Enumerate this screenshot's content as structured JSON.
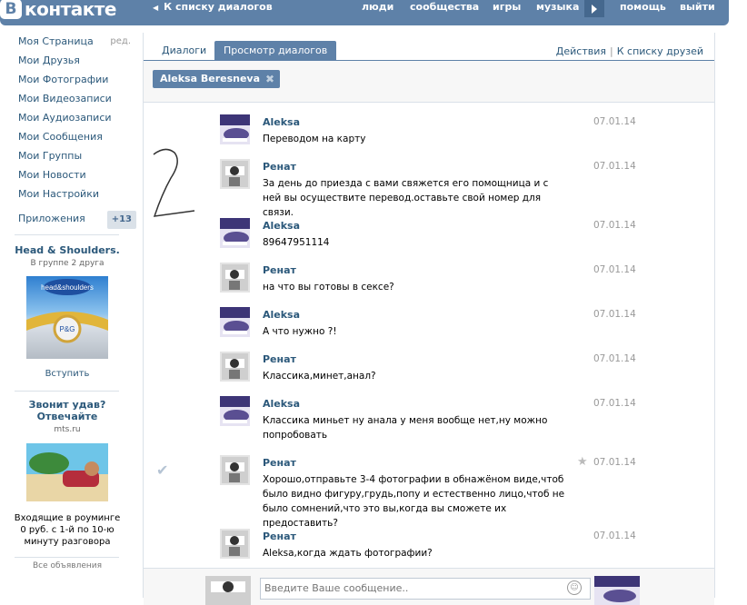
{
  "header": {
    "logo_badge": "В",
    "logo_text": "контакте",
    "back_link": "К списку диалогов",
    "nav": [
      "люди",
      "сообщества",
      "игры",
      "музыка",
      "помощь",
      "выйти"
    ]
  },
  "sidebar": {
    "items": [
      {
        "label": "Моя Страница",
        "edit": "ред."
      },
      {
        "label": "Мои Друзья"
      },
      {
        "label": "Мои Фотографии"
      },
      {
        "label": "Мои Видеозаписи"
      },
      {
        "label": "Мои Аудиозаписи"
      },
      {
        "label": "Мои Сообщения"
      },
      {
        "label": "Мои Группы"
      },
      {
        "label": "Мои Новости"
      },
      {
        "label": "Мои Настройки"
      }
    ],
    "apps": {
      "label": "Приложения",
      "count": "+13"
    },
    "ad1": {
      "title": "Head & Shoulders.",
      "subtitle": "В группе 2 друга",
      "action": "Вступить"
    },
    "ad2": {
      "title": "Звонит удав? Отвечайте",
      "subtitle": "mts.ru",
      "text": "Входящие в роуминге 0 руб. с 1-й по 10-ю минуту разговора"
    },
    "all_ads": "Все объявления"
  },
  "tabs": {
    "dialogs": "Диалоги",
    "view": "Просмотр диалогов",
    "actions": "Действия",
    "sep": "|",
    "friends": "К списку друзей"
  },
  "filter": {
    "chip": "Aleksa Beresneva"
  },
  "messages": [
    {
      "author": "Aleksa",
      "text": "Переводом на карту",
      "date": "07.01.14"
    },
    {
      "author": "Ренат",
      "text": "За день до приезда с вами свяжется его помощница и с ней вы осуществите перевод.оставьте свой номер для связи.",
      "date": "07.01.14"
    },
    {
      "author": "Aleksa",
      "text": "89647951114",
      "date": "07.01.14"
    },
    {
      "author": "Ренат",
      "text": "на что вы готовы в сексе?",
      "date": "07.01.14"
    },
    {
      "author": "Aleksa",
      "text": "А что нужно ?!",
      "date": "07.01.14"
    },
    {
      "author": "Ренат",
      "text": "Классика,минет,анал?",
      "date": "07.01.14"
    },
    {
      "author": "Aleksa",
      "text": "Классика миньет ну анала у меня вообще нет,ну можно попробовать",
      "date": "07.01.14"
    },
    {
      "author": "Ренат",
      "text": "Хорошо,отправьте 3-4 фотографии в обнажёном виде,чтоб было видно фигуру,грудь,попу и естественно лицо,чтоб не было сомнений,что это вы,когда вы сможете их предоставить?",
      "date": "07.01.14"
    },
    {
      "author": "Ренат",
      "text": "Aleksa,когда ждать фотографии?",
      "date": "07.01.14"
    }
  ],
  "compose": {
    "placeholder": "Введите Ваше сообщение.."
  },
  "colors": {
    "header": "#5e81a8",
    "link": "#2b587a",
    "date": "#999999"
  }
}
